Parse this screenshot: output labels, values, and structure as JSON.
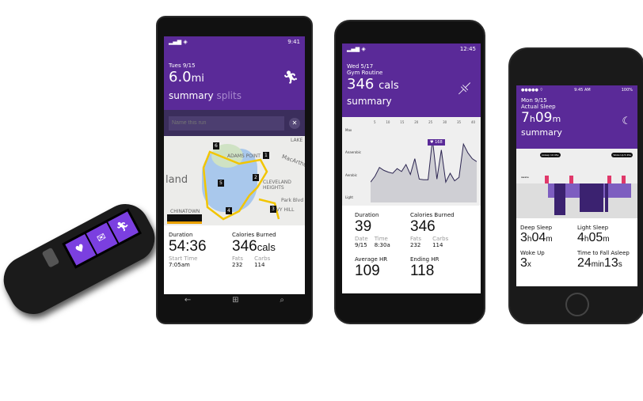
{
  "colors": {
    "accent": "#5a2a98",
    "band_tile": "#7b3fe0",
    "header_dark": "#3b2e5c"
  },
  "band": {
    "tiles": [
      "heart-icon",
      "mail-icon",
      "run-icon"
    ]
  },
  "lumia": {
    "status_time": "9:41",
    "date": "Tues 9/15",
    "distance": "6.0",
    "distance_unit": "mi",
    "tab_active": "summary",
    "tab_inactive": "splits",
    "name_placeholder": "Name this run",
    "map_labels": [
      "land",
      "ADAMS POINT",
      "CLEVELAND HEIGHTS",
      "MacArthur",
      "CHINATOWN",
      "IVY HILL",
      "Park Blvd",
      "LAKE"
    ],
    "split_markers": [
      "1",
      "2",
      "3",
      "4",
      "5",
      "6"
    ],
    "duration_label": "Duration",
    "duration": "54:36",
    "start_time_label": "Start Time",
    "start_time": "7:05am",
    "calories_label": "Calories Burned",
    "calories": "346",
    "calories_unit": "cals",
    "fats_label": "Fats",
    "fats": "232",
    "carbs_label": "Carbs",
    "carbs": "114"
  },
  "nexus": {
    "status_time": "12:45",
    "date": "Wed 5/17",
    "activity": "Gym Routine",
    "calories": "346",
    "calories_unit": "cals",
    "tab": "summary",
    "hr_chart": {
      "x_ticks": [
        "5",
        "10",
        "15",
        "20",
        "25",
        "30",
        "35",
        "40"
      ],
      "zones": [
        "Max",
        "Anaerobic",
        "Aerobic",
        "Light"
      ],
      "peak_label": "168",
      "values": [
        95,
        105,
        120,
        115,
        112,
        110,
        118,
        113,
        125,
        108,
        135,
        100,
        99,
        99,
        168,
        100,
        150,
        95,
        110,
        97,
        103,
        160,
        145,
        135,
        130
      ]
    },
    "duration_label": "Duration",
    "duration": "39",
    "date_label": "Date",
    "date_value": "9/15",
    "time_label": "Time",
    "time_value": "8:30a",
    "calories_label": "Calories Burned",
    "calories_value": "346",
    "fats_label": "Fats",
    "fats": "232",
    "carbs_label": "Carbs",
    "carbs": "114",
    "avg_hr_label": "Average HR",
    "avg_hr": "109",
    "end_hr_label": "Ending HR",
    "end_hr": "118"
  },
  "iphone": {
    "status_time": "9:45 AM",
    "battery": "100%",
    "date": "Mon 9/15",
    "type": "Actual Sleep",
    "hours": "7",
    "hours_unit": "h",
    "minutes": "09",
    "minutes_unit": "m",
    "tab": "summary",
    "asleep_badge": "Asleep 10:45p",
    "woke_badge": "Woke Up 5:45a",
    "rows": [
      "Awake",
      "Light",
      "Restful"
    ],
    "deep_label": "Deep Sleep",
    "deep_h": "3",
    "deep_m": "04",
    "light_label": "Light Sleep",
    "light_h": "4",
    "light_m": "05",
    "woke_label": "Woke Up",
    "woke": "3",
    "woke_unit": "x",
    "fall_label": "Time to Fall Asleep",
    "fall_min": "24",
    "fall_min_unit": "min",
    "fall_s": "13",
    "fall_s_unit": "s"
  }
}
